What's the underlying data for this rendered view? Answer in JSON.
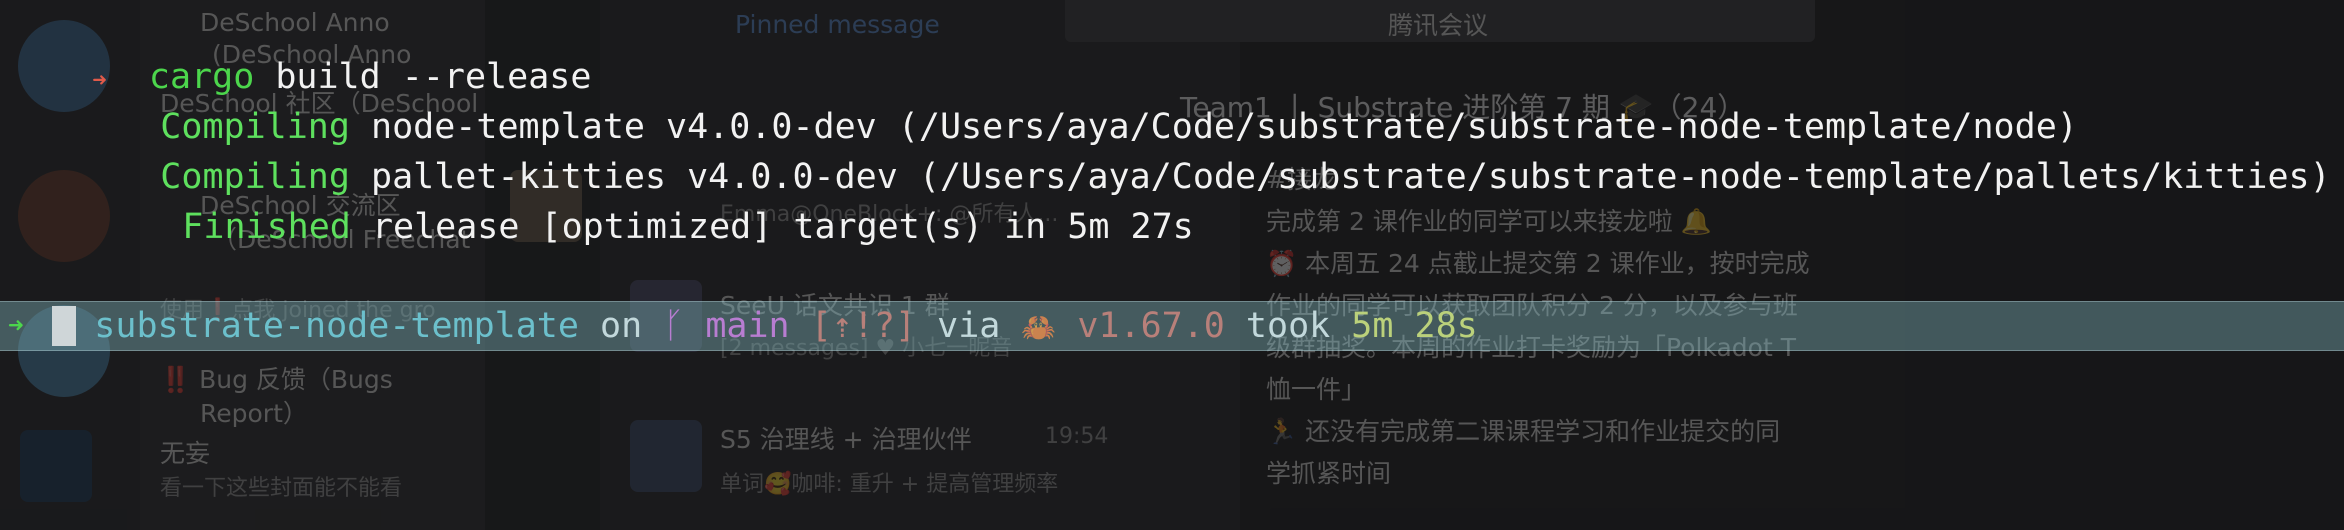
{
  "background_app": {
    "panels": [
      {
        "text": "DeSchool Anno"
      },
      {
        "text": "(DeSchool Anno"
      },
      {
        "text": "DeSchool 社区（DeSchool"
      },
      {
        "text": "DeSchool 交流区"
      },
      {
        "text": "（DeSchool Freechat"
      },
      {
        "text": "使用❗️点我 joined the gro"
      },
      {
        "text": "‼️ Bug 反馈（Bugs"
      },
      {
        "text": "Report）"
      },
      {
        "text": "无妄"
      },
      {
        "text": "看一下这些封面能不能看"
      },
      {
        "text": "Pinned message"
      },
      {
        "text": "腾讯会议"
      },
      {
        "text": "Emma@OneBlock+: @所有人..."
      },
      {
        "text": "SeeU 话文共识 1 群"
      },
      {
        "text": "[2 messages] ♥ 小七一昵音"
      },
      {
        "text": "S5 治理线 + 治理伙伴"
      },
      {
        "text": "19:54"
      },
      {
        "text": "单词🥰咖啡: 重升 + 提高管理频率"
      },
      {
        "text": "Team1 丨 Substrate 进阶第 7 期 🎓（24）"
      },
      {
        "text": "#接龙"
      },
      {
        "text": "完成第 2 课作业的同学可以来接龙啦 🔔"
      },
      {
        "text": "⏰ 本周五 24 点截止提交第 2 课作业，按时完成"
      },
      {
        "text": "作业的同学可以获取团队积分 2 分，以及参与班"
      },
      {
        "text": "级群抽奖。本周的作业打卡奖励为「Polkadot T"
      },
      {
        "text": "恤一件」"
      },
      {
        "text": "🏃 还没有完成第二课课程学习和作业提交的同"
      },
      {
        "text": "学抓紧时间"
      }
    ]
  },
  "terminal": {
    "line1": {
      "arrow": "➜",
      "cmd": "cargo",
      "args": " build --release"
    },
    "line2": {
      "status": "Compiling",
      "rest": " node-template v4.0.0-dev (/Users/aya/Code/substrate/substrate-node-template/node)"
    },
    "line3": {
      "status": "Compiling",
      "rest": " pallet-kitties v4.0.0-dev (/Users/aya/Code/substrate/substrate-node-template/pallets/kitties)"
    },
    "line4": {
      "status": "Finished",
      "rest": " release [optimized] target(s) in 5m 27s"
    },
    "line5": {
      "dir": "substrate-node-template",
      "on": " on ",
      "branch": "ᚴ main",
      "git_status": " [⇡!?]",
      "via": " via ",
      "rust_icon": "🦀",
      "rust_version": " v1.67.0",
      "took": " took ",
      "duration": "5m 28s"
    },
    "prompt": {
      "arrow": "➜"
    }
  },
  "colors": {
    "green": "#4cd64c",
    "cyan": "#5ec8d8",
    "magenta": "#e055e0",
    "red": "#e05a4a",
    "yellow": "#e6e64c"
  }
}
